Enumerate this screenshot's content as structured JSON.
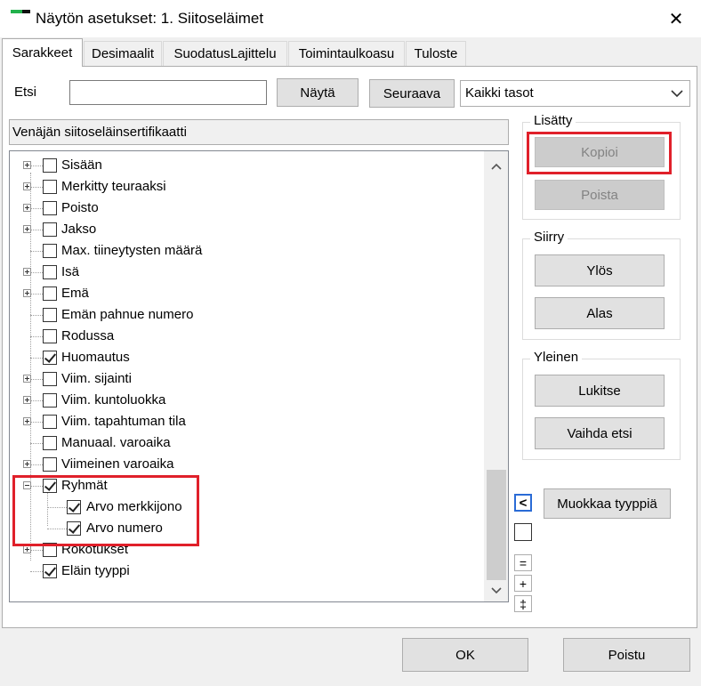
{
  "window": {
    "title": "Näytön asetukset: 1. Siitoseläimet",
    "close_glyph": "✕"
  },
  "tabs": [
    {
      "label": "Sarakkeet",
      "active": true
    },
    {
      "label": "Desimaalit"
    },
    {
      "label": "SuodatusLajittelu"
    },
    {
      "label": "Toimintaulkoasu"
    },
    {
      "label": "Tuloste"
    }
  ],
  "search": {
    "label": "Etsi",
    "value": "",
    "show_button": "Näytä",
    "next_button": "Seuraava",
    "level_select": "Kaikki tasot",
    "dropdown_icon": "chevron-down-icon"
  },
  "selected_header": "Venäjän siitoseläinsertifikaatti",
  "tree": [
    {
      "label": "Sisään",
      "expander": "plus",
      "checked": false,
      "level": 0
    },
    {
      "label": "Merkitty teuraaksi",
      "expander": "plus",
      "checked": false,
      "level": 0
    },
    {
      "label": "Poisto",
      "expander": "plus",
      "checked": false,
      "level": 0
    },
    {
      "label": "Jakso",
      "expander": "plus",
      "checked": false,
      "level": 0
    },
    {
      "label": "Max. tiineytysten määrä",
      "expander": "none",
      "checked": false,
      "level": 0
    },
    {
      "label": "Isä",
      "expander": "plus",
      "checked": false,
      "level": 0
    },
    {
      "label": "Emä",
      "expander": "plus",
      "checked": false,
      "level": 0
    },
    {
      "label": "Emän pahnue numero",
      "expander": "none",
      "checked": false,
      "level": 0
    },
    {
      "label": "Rodussa",
      "expander": "none",
      "checked": false,
      "level": 0
    },
    {
      "label": "Huomautus",
      "expander": "none",
      "checked": true,
      "level": 0
    },
    {
      "label": "Viim. sijainti",
      "expander": "plus",
      "checked": false,
      "level": 0
    },
    {
      "label": "Viim. kuntoluokka",
      "expander": "plus",
      "checked": false,
      "level": 0
    },
    {
      "label": "Viim. tapahtuman tila",
      "expander": "plus",
      "checked": false,
      "level": 0
    },
    {
      "label": "Manuaal. varoaika",
      "expander": "none",
      "checked": false,
      "level": 0
    },
    {
      "label": "Viimeinen varoaika",
      "expander": "plus",
      "checked": false,
      "level": 0
    },
    {
      "label": "Ryhmät",
      "expander": "minus",
      "checked": true,
      "level": 0
    },
    {
      "label": "Arvo merkkijono",
      "expander": "none",
      "checked": true,
      "level": 1
    },
    {
      "label": "Arvo numero",
      "expander": "none",
      "checked": true,
      "level": 1
    },
    {
      "label": "Rokotukset",
      "expander": "plus",
      "checked": false,
      "level": 0
    },
    {
      "label": "Eläin tyyppi",
      "expander": "none",
      "checked": true,
      "level": 0
    }
  ],
  "added_group": {
    "label": "Lisätty",
    "copy_button": "Kopioi",
    "delete_button": "Poista"
  },
  "move_group": {
    "label": "Siirry",
    "up_button": "Ylös",
    "down_button": "Alas"
  },
  "general_group": {
    "label": "Yleinen",
    "lock_button": "Lukitse",
    "switch_search_button": "Vaihda etsi"
  },
  "side_controls": {
    "arrow_glyph": "<",
    "edit_type_button": "Muokkaa tyyppiä",
    "equals_glyph": "=",
    "plus_glyph": "+",
    "double_dagger_glyph": "‡"
  },
  "footer": {
    "ok_button": "OK",
    "exit_button": "Poistu"
  },
  "colors": {
    "highlight": "#e0202a",
    "accent_green": "#22b14c"
  }
}
